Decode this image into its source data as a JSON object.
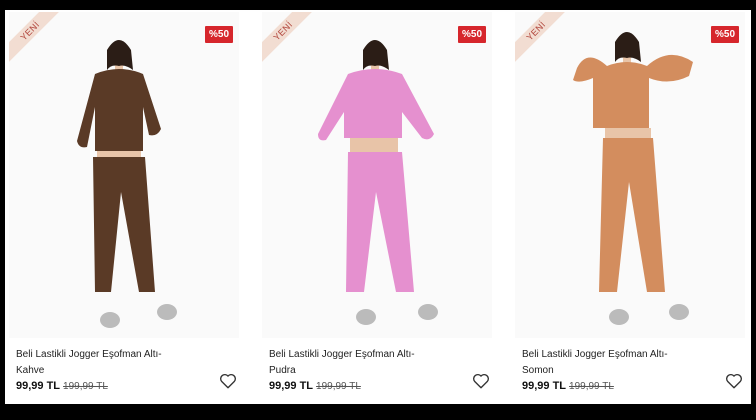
{
  "products": [
    {
      "badge": "YENİ",
      "discount": "%50",
      "title_line1": "Beli Lastikli Jogger Eşofman Altı-",
      "title_line2": "Kahve",
      "price": "99,99 TL",
      "old_price": "199,99 TL",
      "color": "#5a3a26"
    },
    {
      "badge": "YENİ",
      "discount": "%50",
      "title_line1": "Beli Lastikli Jogger Eşofman Altı-",
      "title_line2": "Pudra",
      "price": "99,99 TL",
      "old_price": "199,99 TL",
      "color": "#e590cf"
    },
    {
      "badge": "YENİ",
      "discount": "%50",
      "title_line1": "Beli Lastikli Jogger Eşofman Altı-",
      "title_line2": "Somon",
      "price": "99,99 TL",
      "old_price": "199,99 TL",
      "color": "#d38d5e"
    }
  ],
  "icons": {
    "favorite": "heart-outline-icon"
  }
}
